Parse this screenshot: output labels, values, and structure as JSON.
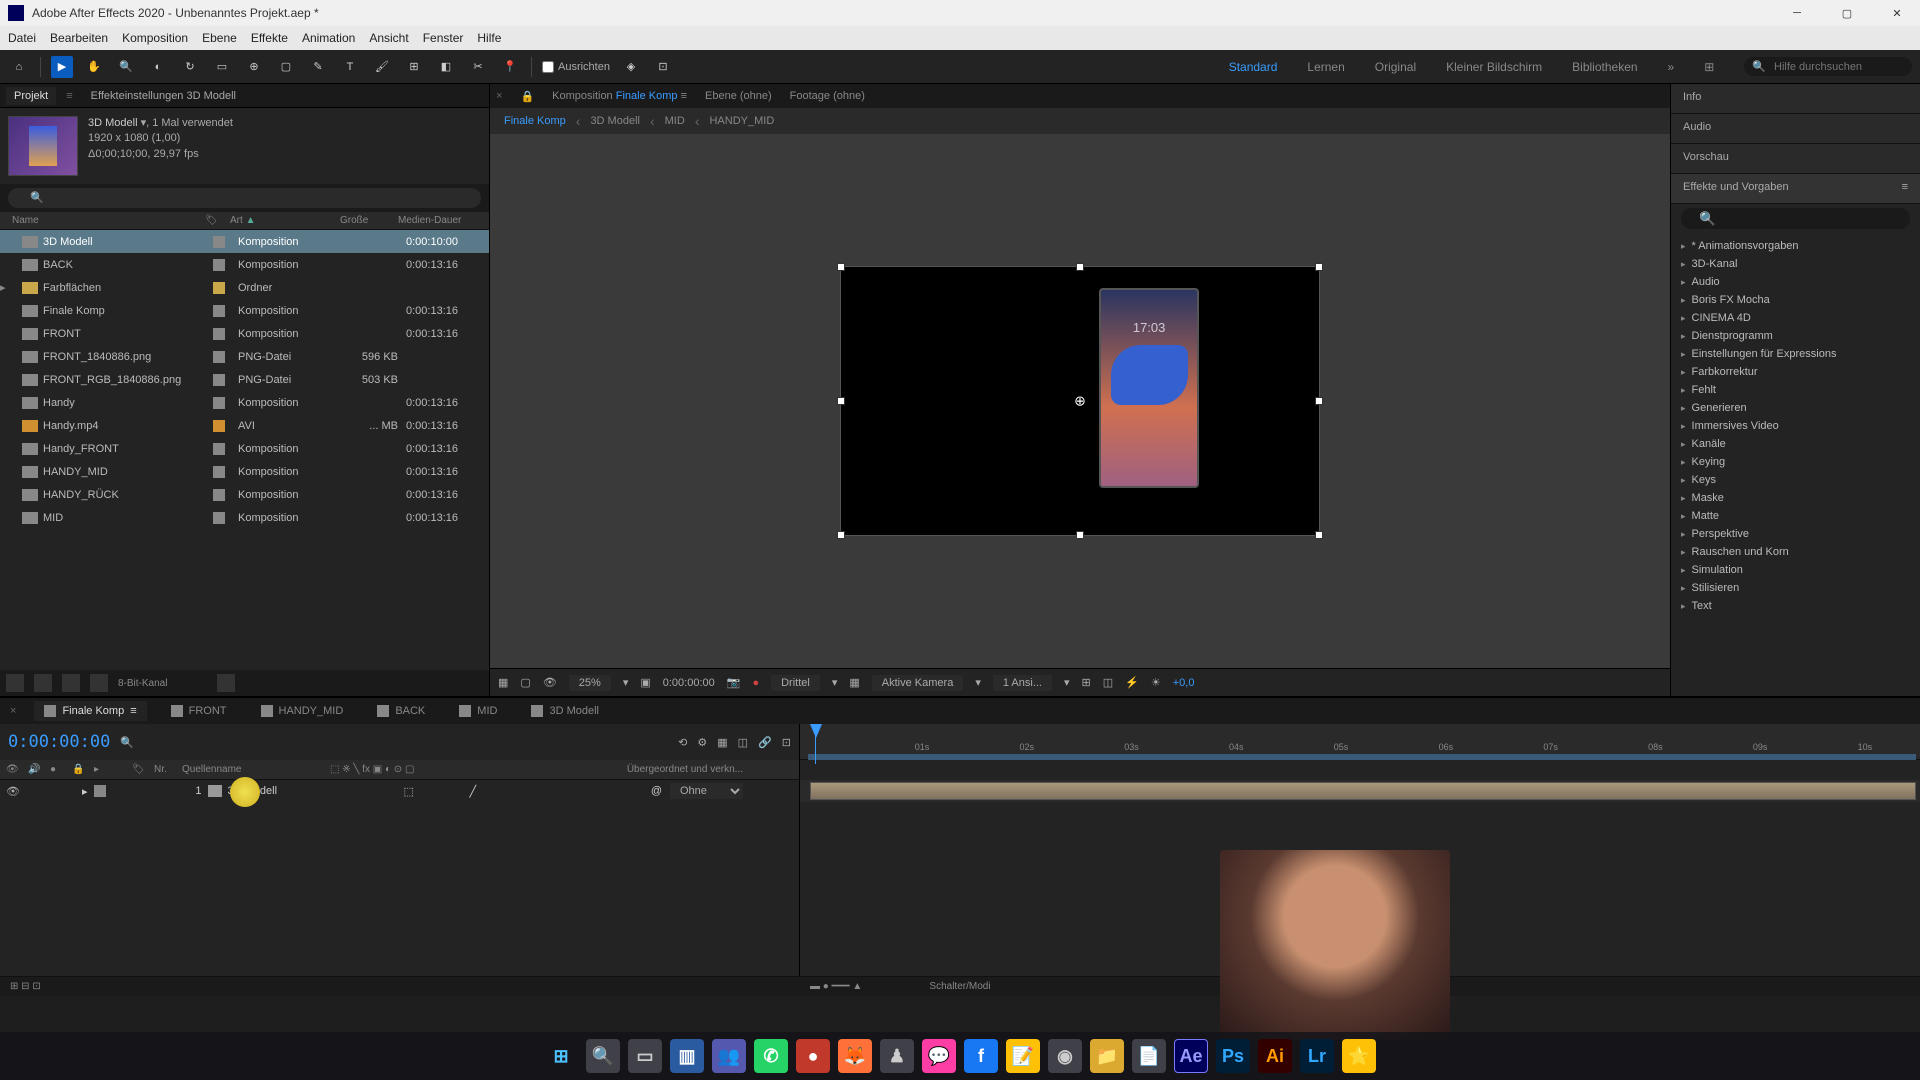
{
  "titlebar": {
    "title": "Adobe After Effects 2020 - Unbenanntes Projekt.aep *"
  },
  "menubar": [
    "Datei",
    "Bearbeiten",
    "Komposition",
    "Ebene",
    "Effekte",
    "Animation",
    "Ansicht",
    "Fenster",
    "Hilfe"
  ],
  "toolbar": {
    "align_label": "Ausrichten",
    "workspaces": [
      "Standard",
      "Lernen",
      "Original",
      "Kleiner Bildschirm",
      "Bibliotheken"
    ],
    "active_workspace": "Standard",
    "search_placeholder": "Hilfe durchsuchen"
  },
  "project": {
    "panel_tabs": [
      "Projekt",
      "Effekteinstellungen 3D Modell"
    ],
    "info_name": "3D Modell",
    "info_usage": ", 1 Mal verwendet",
    "info_dims": "1920 x 1080 (1,00)",
    "info_dur": "Δ0;00;10;00, 29,97 fps",
    "search_placeholder": "",
    "columns": {
      "name": "Name",
      "art": "Art",
      "size": "Große",
      "dur": "Medien-Dauer"
    },
    "rows": [
      {
        "name": "3D Modell",
        "art": "Komposition",
        "size": "",
        "dur": "0:00:10:00",
        "icon": "comp",
        "label": "#888",
        "selected": true
      },
      {
        "name": "BACK",
        "art": "Komposition",
        "size": "",
        "dur": "0:00:13:16",
        "icon": "comp",
        "label": "#888"
      },
      {
        "name": "Farbflächen",
        "art": "Ordner",
        "size": "",
        "dur": "",
        "icon": "folder",
        "label": "#c9a84b"
      },
      {
        "name": "Finale Komp",
        "art": "Komposition",
        "size": "",
        "dur": "0:00:13:16",
        "icon": "comp",
        "label": "#888"
      },
      {
        "name": "FRONT",
        "art": "Komposition",
        "size": "",
        "dur": "0:00:13:16",
        "icon": "comp",
        "label": "#888"
      },
      {
        "name": "FRONT_1840886.png",
        "art": "PNG-Datei",
        "size": "596 KB",
        "dur": "",
        "icon": "png",
        "label": "#888"
      },
      {
        "name": "FRONT_RGB_1840886.png",
        "art": "PNG-Datei",
        "size": "503 KB",
        "dur": "",
        "icon": "png",
        "label": "#888"
      },
      {
        "name": "Handy",
        "art": "Komposition",
        "size": "",
        "dur": "0:00:13:16",
        "icon": "comp",
        "label": "#888"
      },
      {
        "name": "Handy.mp4",
        "art": "AVI",
        "size": "... MB",
        "dur": "0:00:13:16",
        "icon": "avi",
        "label": "#d09030"
      },
      {
        "name": "Handy_FRONT",
        "art": "Komposition",
        "size": "",
        "dur": "0:00:13:16",
        "icon": "comp",
        "label": "#888"
      },
      {
        "name": "HANDY_MID",
        "art": "Komposition",
        "size": "",
        "dur": "0:00:13:16",
        "icon": "comp",
        "label": "#888"
      },
      {
        "name": "HANDY_RÜCK",
        "art": "Komposition",
        "size": "",
        "dur": "0:00:13:16",
        "icon": "comp",
        "label": "#888"
      },
      {
        "name": "MID",
        "art": "Komposition",
        "size": "",
        "dur": "0:00:13:16",
        "icon": "comp",
        "label": "#888"
      }
    ],
    "footer_bpc": "8-Bit-Kanal"
  },
  "comp_panel": {
    "tabs": [
      {
        "prefix": "Komposition",
        "name": "Finale Komp",
        "active": true
      },
      {
        "prefix": "Ebene",
        "name": "(ohne)"
      },
      {
        "prefix": "Footage",
        "name": "(ohne)"
      }
    ],
    "breadcrumb": [
      "Finale Komp",
      "3D Modell",
      "MID",
      "HANDY_MID"
    ],
    "footer": {
      "zoom": "25%",
      "timecode": "0:00:00:00",
      "quality": "Drittel",
      "camera": "Aktive Kamera",
      "views": "1 Ansi...",
      "exposure": "+0,0"
    }
  },
  "right_panel": {
    "tabs": [
      "Info",
      "Audio",
      "Vorschau"
    ],
    "effects_title": "Effekte und Vorgaben",
    "effects": [
      "* Animationsvorgaben",
      "3D-Kanal",
      "Audio",
      "Boris FX Mocha",
      "CINEMA 4D",
      "Dienstprogramm",
      "Einstellungen für Expressions",
      "Farbkorrektur",
      "Fehlt",
      "Generieren",
      "Immersives Video",
      "Kanäle",
      "Keying",
      "Keys",
      "Maske",
      "Matte",
      "Perspektive",
      "Rauschen und Korn",
      "Simulation",
      "Stilisieren",
      "Text"
    ]
  },
  "timeline": {
    "tabs": [
      {
        "name": "Finale Komp",
        "active": true
      },
      {
        "name": "FRONT"
      },
      {
        "name": "HANDY_MID"
      },
      {
        "name": "BACK"
      },
      {
        "name": "MID"
      },
      {
        "name": "3D Modell"
      }
    ],
    "timecode": "0:00:00:00",
    "cols": {
      "nr": "Nr.",
      "source": "Quellenname",
      "parent": "Übergeordnet und verkn..."
    },
    "layer": {
      "num": "1",
      "name": "3D Modell",
      "parent": "Ohne"
    },
    "ruler": [
      "01s",
      "02s",
      "03s",
      "04s",
      "05s",
      "06s",
      "07s",
      "08s",
      "09s",
      "10s"
    ],
    "footer": "Schalter/Modi"
  },
  "taskbar": {
    "icons": [
      "win",
      "search",
      "tasks",
      "explorer",
      "teams",
      "whatsapp",
      "app1",
      "firefox",
      "app2",
      "messenger",
      "facebook",
      "notes",
      "obs",
      "folder",
      "notepad",
      "ae",
      "ps",
      "ai",
      "lr",
      "star"
    ]
  }
}
